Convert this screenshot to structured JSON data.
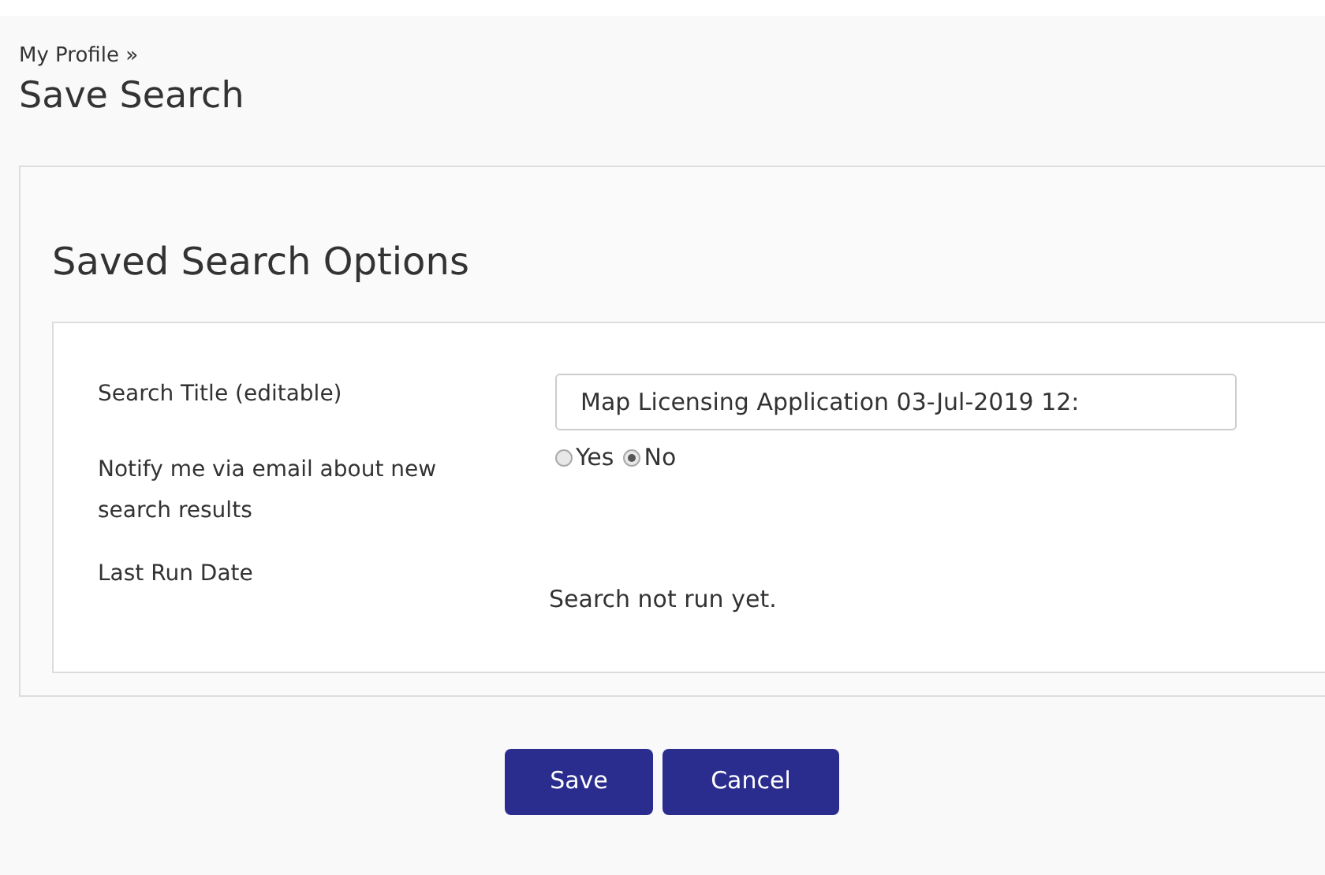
{
  "breadcrumb": "My Profile »",
  "title": "Save Search",
  "panel": {
    "heading": "Saved Search Options",
    "fields": [
      {
        "kind": "text",
        "label": "Search Title (editable)",
        "value": "Map Licensing Application 03-Jul-2019 12:"
      },
      {
        "kind": "radio",
        "label": "Notify me via email about new search results",
        "options": [
          {
            "label": "Yes",
            "selected": false
          },
          {
            "label": "No",
            "selected": true
          }
        ]
      },
      {
        "kind": "static",
        "label": "Last Run Date",
        "value": "Search not run yet."
      }
    ]
  },
  "buttons": [
    "Save",
    "Cancel"
  ]
}
